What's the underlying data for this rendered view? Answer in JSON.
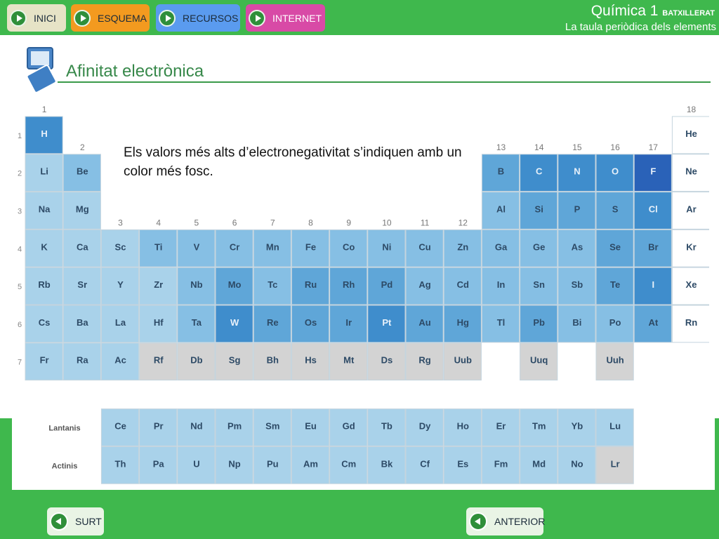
{
  "nav": {
    "inici": "INICI",
    "esquema": "ESQUEMA",
    "recursos": "RECURSOS",
    "internet": "INTERNET"
  },
  "header": {
    "title": "Química 1",
    "title_suffix": "BATXILLERAT",
    "subtitle": "La taula periòdica dels elements"
  },
  "section": {
    "title": "Afinitat electrònica"
  },
  "note": "Els valors més alts d’electronegativitat s’indiquen amb un color més fosc.",
  "table": {
    "group_labels": [
      {
        "g": 1,
        "label": "1"
      },
      {
        "g": 2,
        "label": "2"
      },
      {
        "g": 3,
        "label": "3"
      },
      {
        "g": 4,
        "label": "4"
      },
      {
        "g": 5,
        "label": "5"
      },
      {
        "g": 6,
        "label": "6"
      },
      {
        "g": 7,
        "label": "7"
      },
      {
        "g": 8,
        "label": "8"
      },
      {
        "g": 9,
        "label": "9"
      },
      {
        "g": 10,
        "label": "10"
      },
      {
        "g": 11,
        "label": "11"
      },
      {
        "g": 12,
        "label": "12"
      },
      {
        "g": 13,
        "label": "13"
      },
      {
        "g": 14,
        "label": "14"
      },
      {
        "g": 15,
        "label": "15"
      },
      {
        "g": 16,
        "label": "16"
      },
      {
        "g": 17,
        "label": "17"
      },
      {
        "g": 18,
        "label": "18"
      }
    ],
    "period_labels": [
      "1",
      "2",
      "3",
      "4",
      "5",
      "6",
      "7"
    ],
    "elements": [
      {
        "s": "H",
        "p": 1,
        "g": 1,
        "level": 4
      },
      {
        "s": "He",
        "p": 1,
        "g": 18,
        "level": 0
      },
      {
        "s": "Li",
        "p": 2,
        "g": 1,
        "level": 1
      },
      {
        "s": "Be",
        "p": 2,
        "g": 2,
        "level": 2
      },
      {
        "s": "B",
        "p": 2,
        "g": 13,
        "level": 3
      },
      {
        "s": "C",
        "p": 2,
        "g": 14,
        "level": 4
      },
      {
        "s": "N",
        "p": 2,
        "g": 15,
        "level": 4
      },
      {
        "s": "O",
        "p": 2,
        "g": 16,
        "level": 4
      },
      {
        "s": "F",
        "p": 2,
        "g": 17,
        "level": 5
      },
      {
        "s": "Ne",
        "p": 2,
        "g": 18,
        "level": 0
      },
      {
        "s": "Na",
        "p": 3,
        "g": 1,
        "level": 1
      },
      {
        "s": "Mg",
        "p": 3,
        "g": 2,
        "level": 1
      },
      {
        "s": "Al",
        "p": 3,
        "g": 13,
        "level": 2
      },
      {
        "s": "Si",
        "p": 3,
        "g": 14,
        "level": 3
      },
      {
        "s": "P",
        "p": 3,
        "g": 15,
        "level": 3
      },
      {
        "s": "S",
        "p": 3,
        "g": 16,
        "level": 3
      },
      {
        "s": "Cl",
        "p": 3,
        "g": 17,
        "level": 4
      },
      {
        "s": "Ar",
        "p": 3,
        "g": 18,
        "level": 0
      },
      {
        "s": "K",
        "p": 4,
        "g": 1,
        "level": 1
      },
      {
        "s": "Ca",
        "p": 4,
        "g": 2,
        "level": 1
      },
      {
        "s": "Sc",
        "p": 4,
        "g": 3,
        "level": 1
      },
      {
        "s": "Ti",
        "p": 4,
        "g": 4,
        "level": 2
      },
      {
        "s": "V",
        "p": 4,
        "g": 5,
        "level": 2
      },
      {
        "s": "Cr",
        "p": 4,
        "g": 6,
        "level": 2
      },
      {
        "s": "Mn",
        "p": 4,
        "g": 7,
        "level": 2
      },
      {
        "s": "Fe",
        "p": 4,
        "g": 8,
        "level": 2
      },
      {
        "s": "Co",
        "p": 4,
        "g": 9,
        "level": 2
      },
      {
        "s": "Ni",
        "p": 4,
        "g": 10,
        "level": 2
      },
      {
        "s": "Cu",
        "p": 4,
        "g": 11,
        "level": 2
      },
      {
        "s": "Zn",
        "p": 4,
        "g": 12,
        "level": 2
      },
      {
        "s": "Ga",
        "p": 4,
        "g": 13,
        "level": 2
      },
      {
        "s": "Ge",
        "p": 4,
        "g": 14,
        "level": 2
      },
      {
        "s": "As",
        "p": 4,
        "g": 15,
        "level": 2
      },
      {
        "s": "Se",
        "p": 4,
        "g": 16,
        "level": 3
      },
      {
        "s": "Br",
        "p": 4,
        "g": 17,
        "level": 3
      },
      {
        "s": "Kr",
        "p": 4,
        "g": 18,
        "level": 0
      },
      {
        "s": "Rb",
        "p": 5,
        "g": 1,
        "level": 1
      },
      {
        "s": "Sr",
        "p": 5,
        "g": 2,
        "level": 1
      },
      {
        "s": "Y",
        "p": 5,
        "g": 3,
        "level": 1
      },
      {
        "s": "Zr",
        "p": 5,
        "g": 4,
        "level": 1
      },
      {
        "s": "Nb",
        "p": 5,
        "g": 5,
        "level": 2
      },
      {
        "s": "Mo",
        "p": 5,
        "g": 6,
        "level": 3
      },
      {
        "s": "Tc",
        "p": 5,
        "g": 7,
        "level": 2
      },
      {
        "s": "Ru",
        "p": 5,
        "g": 8,
        "level": 3
      },
      {
        "s": "Rh",
        "p": 5,
        "g": 9,
        "level": 3
      },
      {
        "s": "Pd",
        "p": 5,
        "g": 10,
        "level": 3
      },
      {
        "s": "Ag",
        "p": 5,
        "g": 11,
        "level": 2
      },
      {
        "s": "Cd",
        "p": 5,
        "g": 12,
        "level": 2
      },
      {
        "s": "In",
        "p": 5,
        "g": 13,
        "level": 2
      },
      {
        "s": "Sn",
        "p": 5,
        "g": 14,
        "level": 2
      },
      {
        "s": "Sb",
        "p": 5,
        "g": 15,
        "level": 2
      },
      {
        "s": "Te",
        "p": 5,
        "g": 16,
        "level": 3
      },
      {
        "s": "I",
        "p": 5,
        "g": 17,
        "level": 4
      },
      {
        "s": "Xe",
        "p": 5,
        "g": 18,
        "level": 0
      },
      {
        "s": "Cs",
        "p": 6,
        "g": 1,
        "level": 1
      },
      {
        "s": "Ba",
        "p": 6,
        "g": 2,
        "level": 1
      },
      {
        "s": "La",
        "p": 6,
        "g": 3,
        "level": 1
      },
      {
        "s": "Hf",
        "p": 6,
        "g": 4,
        "level": 1
      },
      {
        "s": "Ta",
        "p": 6,
        "g": 5,
        "level": 2
      },
      {
        "s": "W",
        "p": 6,
        "g": 6,
        "level": 4
      },
      {
        "s": "Re",
        "p": 6,
        "g": 7,
        "level": 3
      },
      {
        "s": "Os",
        "p": 6,
        "g": 8,
        "level": 3
      },
      {
        "s": "Ir",
        "p": 6,
        "g": 9,
        "level": 3
      },
      {
        "s": "Pt",
        "p": 6,
        "g": 10,
        "level": 4
      },
      {
        "s": "Au",
        "p": 6,
        "g": 11,
        "level": 3
      },
      {
        "s": "Hg",
        "p": 6,
        "g": 12,
        "level": 3
      },
      {
        "s": "Tl",
        "p": 6,
        "g": 13,
        "level": 2
      },
      {
        "s": "Pb",
        "p": 6,
        "g": 14,
        "level": 3
      },
      {
        "s": "Bi",
        "p": 6,
        "g": 15,
        "level": 2
      },
      {
        "s": "Po",
        "p": 6,
        "g": 16,
        "level": 2
      },
      {
        "s": "At",
        "p": 6,
        "g": 17,
        "level": 3
      },
      {
        "s": "Rn",
        "p": 6,
        "g": 18,
        "level": 0
      },
      {
        "s": "Fr",
        "p": 7,
        "g": 1,
        "level": 1
      },
      {
        "s": "Ra",
        "p": 7,
        "g": 2,
        "level": 1
      },
      {
        "s": "Ac",
        "p": 7,
        "g": 3,
        "level": 1
      },
      {
        "s": "Rf",
        "p": 7,
        "g": 4,
        "level": -1
      },
      {
        "s": "Db",
        "p": 7,
        "g": 5,
        "level": -1
      },
      {
        "s": "Sg",
        "p": 7,
        "g": 6,
        "level": -1
      },
      {
        "s": "Bh",
        "p": 7,
        "g": 7,
        "level": -1
      },
      {
        "s": "Hs",
        "p": 7,
        "g": 8,
        "level": -1
      },
      {
        "s": "Mt",
        "p": 7,
        "g": 9,
        "level": -1
      },
      {
        "s": "Ds",
        "p": 7,
        "g": 10,
        "level": -1
      },
      {
        "s": "Rg",
        "p": 7,
        "g": 11,
        "level": -1
      },
      {
        "s": "Uub",
        "p": 7,
        "g": 12,
        "level": -1
      },
      {
        "s": "Uuq",
        "p": 7,
        "g": 14,
        "level": -1
      },
      {
        "s": "Uuh",
        "p": 7,
        "g": 16,
        "level": -1
      }
    ],
    "series_labels": [
      "Lantanis",
      "Actinis"
    ],
    "lanthanides": [
      {
        "s": "Ce",
        "level": 1
      },
      {
        "s": "Pr",
        "level": 1
      },
      {
        "s": "Nd",
        "level": 1
      },
      {
        "s": "Pm",
        "level": 1
      },
      {
        "s": "Sm",
        "level": 1
      },
      {
        "s": "Eu",
        "level": 1
      },
      {
        "s": "Gd",
        "level": 1
      },
      {
        "s": "Tb",
        "level": 1
      },
      {
        "s": "Dy",
        "level": 1
      },
      {
        "s": "Ho",
        "level": 1
      },
      {
        "s": "Er",
        "level": 1
      },
      {
        "s": "Tm",
        "level": 1
      },
      {
        "s": "Yb",
        "level": 1
      },
      {
        "s": "Lu",
        "level": 1
      }
    ],
    "actinides": [
      {
        "s": "Th",
        "level": 1
      },
      {
        "s": "Pa",
        "level": 1
      },
      {
        "s": "U",
        "level": 1
      },
      {
        "s": "Np",
        "level": 1
      },
      {
        "s": "Pu",
        "level": 1
      },
      {
        "s": "Am",
        "level": 1
      },
      {
        "s": "Cm",
        "level": 1
      },
      {
        "s": "Bk",
        "level": 1
      },
      {
        "s": "Cf",
        "level": 1
      },
      {
        "s": "Es",
        "level": 1
      },
      {
        "s": "Fm",
        "level": 1
      },
      {
        "s": "Md",
        "level": 1
      },
      {
        "s": "No",
        "level": 1
      },
      {
        "s": "Lr",
        "level": -1
      }
    ]
  },
  "colors": {
    "level_-1": "#d3d3d3",
    "level_0": "#ffffff",
    "level_1": "#a9d2ea",
    "level_2": "#86bfe4",
    "level_3": "#5fa6d8",
    "level_4": "#3f8dcc",
    "level_5": "#2a62b8"
  },
  "footer": {
    "surt": "SURT",
    "anterior": "ANTERIOR"
  }
}
